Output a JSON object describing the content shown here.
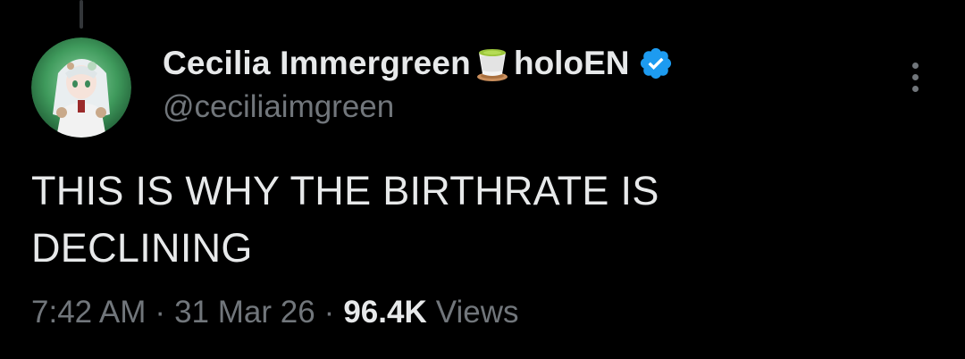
{
  "author": {
    "display_name": "Cecilia Immergreen",
    "name_emoji": "tea-cup-icon",
    "org": "holoEN",
    "handle": "@ceciliaimgreen",
    "verified": true,
    "verified_color": "#1d9bf0"
  },
  "tweet": {
    "text": "THIS IS WHY THE BIRTHRATE IS\nDECLINING",
    "time": "7:42 AM",
    "date": "31 Mar 26",
    "separator": "·",
    "views_count": "96.4K",
    "views_label": "Views"
  },
  "colors": {
    "background": "#000000",
    "primary_text": "#e7e9ea",
    "secondary_text": "#71767b",
    "avatar_ring": "#2d8a4e"
  },
  "icons": {
    "more": "more-vertical-icon",
    "verified": "verified-badge-icon"
  }
}
